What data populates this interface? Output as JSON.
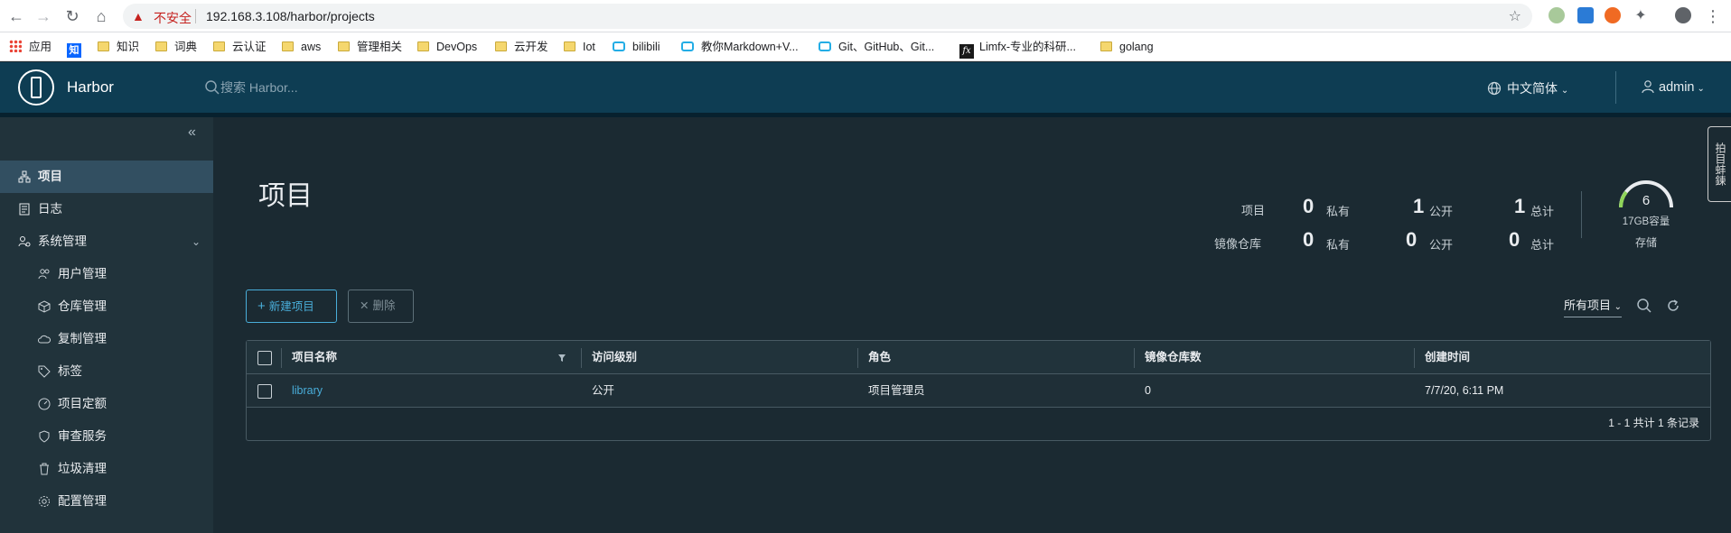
{
  "browser": {
    "insecure_label": "不安全",
    "url": "192.168.3.108/harbor/projects"
  },
  "bookmarks": [
    "应用",
    "知识",
    "词典",
    "云认证",
    "aws",
    "管理相关",
    "DevOps",
    "云开发",
    "Iot",
    "bilibili",
    "教你Markdown+V...",
    "Git、GitHub、Git...",
    "Limfx-专业的科研...",
    "golang"
  ],
  "header": {
    "app_name": "Harbor",
    "search_placeholder": "搜索 Harbor...",
    "language": "中文简体",
    "user": "admin"
  },
  "sidebar": {
    "items": [
      {
        "label": "项目"
      },
      {
        "label": "日志"
      },
      {
        "label": "系统管理"
      }
    ],
    "sub_items": [
      {
        "label": "用户管理"
      },
      {
        "label": "仓库管理"
      },
      {
        "label": "复制管理"
      },
      {
        "label": "标签"
      },
      {
        "label": "项目定额"
      },
      {
        "label": "审查服务"
      },
      {
        "label": "垃圾清理"
      },
      {
        "label": "配置管理"
      }
    ]
  },
  "main": {
    "title": "项目",
    "summary": {
      "projects_label": "项目",
      "repos_label": "镜像仓库",
      "projects_private": "0",
      "projects_public": "1",
      "projects_total": "1",
      "repos_private": "0",
      "repos_public": "0",
      "repos_total": "0",
      "private_label": "私有",
      "public_label": "公开",
      "total_label": "总计"
    },
    "storage": {
      "value": "6",
      "capacity": "17GB容量",
      "label": "存储"
    },
    "new_button": "新建项目",
    "delete_button": "删除",
    "filter_value": "所有项目",
    "table": {
      "columns": [
        "项目名称",
        "访问级别",
        "角色",
        "镜像仓库数",
        "创建时间"
      ],
      "rows": [
        {
          "name": "library",
          "access": "公开",
          "role": "项目管理员",
          "repo_count": "0",
          "created": "7/7/20, 6:11 PM"
        }
      ],
      "footer": "1 - 1 共计 1 条记录"
    },
    "side_tab": "拍目蚌鍊"
  },
  "colors": {
    "header_bg": "#0e3d53",
    "sidebar_bg": "#21333b",
    "main_bg": "#1b2a32",
    "accent": "#49aeda",
    "active_nav": "#324f61"
  }
}
